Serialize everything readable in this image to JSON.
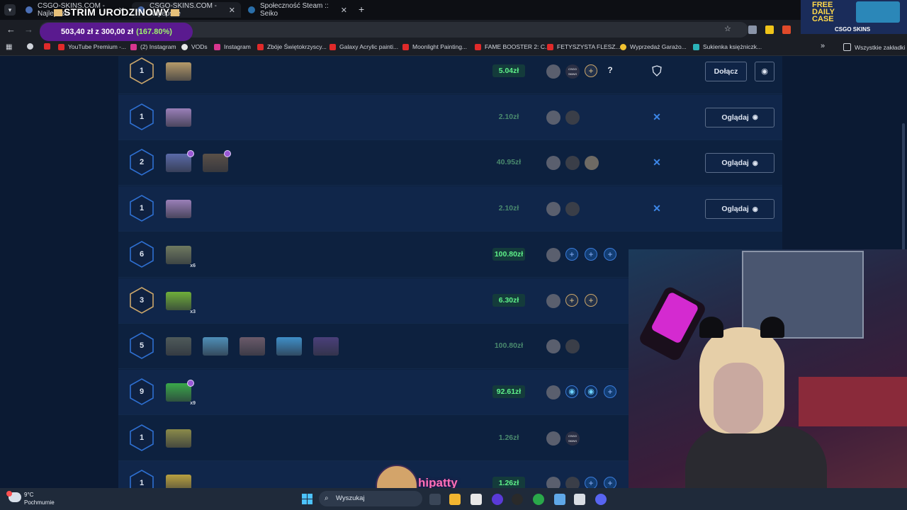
{
  "browser": {
    "tabs": [
      {
        "title": "CSGO-SKINS.COM - Najlepsze",
        "active": false
      },
      {
        "title": "CSGO-SKINS.COM - Najlepsze",
        "active": true
      },
      {
        "title": "Społeczność Steam :: Seiko",
        "active": false
      }
    ],
    "new_tab": "+",
    "bookmarks": [
      {
        "label": "YouTube Premium -...",
        "color": "#e02a2a"
      },
      {
        "label": "(2) Instagram",
        "color": "#d8368f"
      },
      {
        "label": "VODs",
        "color": "#e8e8e8"
      },
      {
        "label": "Instagram",
        "color": "#d8368f"
      },
      {
        "label": "Zbóje Świętokrzyscy...",
        "color": "#e02a2a"
      },
      {
        "label": "Galaxy Acrylic painti...",
        "color": "#e02a2a"
      },
      {
        "label": "Moonlight Painting...",
        "color": "#e02a2a"
      },
      {
        "label": "FAME BOOSTER 2: C...",
        "color": "#e02a2a"
      },
      {
        "label": "FETYSZYSTA FLESZ...",
        "color": "#e02a2a"
      },
      {
        "label": "Wyprzedaż Garażo...",
        "color": "#f2c230"
      },
      {
        "label": "Sukienka księżniczk...",
        "color": "#2bb3b8"
      }
    ],
    "all_bookmarks": "Wszystkie zakładki"
  },
  "stream_overlay": {
    "title": "STRIM URODZINOWY",
    "goal_text": "503,40 zł z 300,00 zł",
    "goal_pct": "(167.80%)",
    "promo_text": "FREE DAILY CASE",
    "promo_brand": "CSGO SKINS",
    "streamer_name": "hipatty"
  },
  "battles": [
    {
      "rounds": "1",
      "ring": "gold",
      "price": "5.04zł",
      "price_active": true,
      "action": "Dołącz",
      "mode_icon": "shield-icon",
      "crates": [
        {
          "color": "#b59a6a"
        }
      ],
      "players": [
        "avatar",
        "avatar-logo",
        "plus-gold",
        "question"
      ]
    },
    {
      "rounds": "1",
      "ring": "blue",
      "price": "2.10zł",
      "price_active": false,
      "action": "Oglądaj",
      "mode_icon": "crossed-swords-icon",
      "crates": [
        {
          "color": "#9a7fb8"
        }
      ],
      "players": [
        "avatar",
        "avatar"
      ]
    },
    {
      "rounds": "2",
      "ring": "blue",
      "price": "40.95zł",
      "price_active": false,
      "action": "Oglądaj",
      "mode_icon": "crossed-swords-icon",
      "crates": [
        {
          "color": "#5a6aa8",
          "badge": true
        },
        {
          "color": "#5a5048",
          "badge": true
        }
      ],
      "players": [
        "avatar",
        "avatar",
        "avatar"
      ]
    },
    {
      "rounds": "1",
      "ring": "blue",
      "price": "2.10zł",
      "price_active": false,
      "action": "Oglądaj",
      "mode_icon": "crossed-swords-icon",
      "crates": [
        {
          "color": "#9a7fb8"
        }
      ],
      "players": [
        "avatar",
        "avatar"
      ]
    },
    {
      "rounds": "6",
      "ring": "blue",
      "price": "100.80zł",
      "price_active": true,
      "action": "",
      "mode_icon": "",
      "crates": [
        {
          "color": "#6f7a60",
          "mult": "x6"
        }
      ],
      "players": [
        "avatar",
        "plus-blue",
        "plus-blue",
        "plus-blue"
      ]
    },
    {
      "rounds": "3",
      "ring": "gold",
      "price": "6.30zł",
      "price_active": true,
      "action": "",
      "mode_icon": "",
      "crates": [
        {
          "color": "#6fae3a",
          "mult": "x3"
        }
      ],
      "players": [
        "avatar",
        "plus-gold",
        "plus-gold"
      ]
    },
    {
      "rounds": "5",
      "ring": "blue",
      "price": "100.80zł",
      "price_active": false,
      "action": "",
      "mode_icon": "",
      "crates": [
        {
          "color": "#4f5a5a"
        },
        {
          "color": "#4f8fb8"
        },
        {
          "color": "#6a5a6a"
        },
        {
          "color": "#3f8fc8"
        },
        {
          "color": "#4a3f7a"
        }
      ],
      "players": [
        "avatar",
        "avatar"
      ]
    },
    {
      "rounds": "9",
      "ring": "blue",
      "price": "92.61zł",
      "price_active": true,
      "action": "",
      "mode_icon": "",
      "crates": [
        {
          "color": "#3aa84a",
          "mult": "x9",
          "badge": true
        }
      ],
      "players": [
        "avatar",
        "target",
        "target",
        "plus-blue"
      ]
    },
    {
      "rounds": "1",
      "ring": "blue",
      "price": "1.26zł",
      "price_active": false,
      "action": "",
      "mode_icon": "",
      "crates": [
        {
          "color": "#8a8a4a"
        }
      ],
      "players": [
        "avatar",
        "avatar-logo"
      ]
    },
    {
      "rounds": "1",
      "ring": "blue",
      "price": "1.26zł",
      "price_active": true,
      "action": "",
      "mode_icon": "",
      "crates": [
        {
          "color": "#b8a040"
        }
      ],
      "players": [
        "avatar",
        "avatar",
        "plus-blue",
        "plus-blue"
      ]
    }
  ],
  "labels": {
    "question": "?",
    "plus": "+",
    "logo": "CSGO SKINS"
  },
  "taskbar": {
    "temp": "9°C",
    "weather": "Pochmurnie",
    "search_placeholder": "Wyszukaj"
  },
  "colors": {
    "accent_green": "#5ff38a",
    "accent_blue": "#3d87e8",
    "gold": "#c9a56a",
    "bg": "#0b1a33"
  }
}
